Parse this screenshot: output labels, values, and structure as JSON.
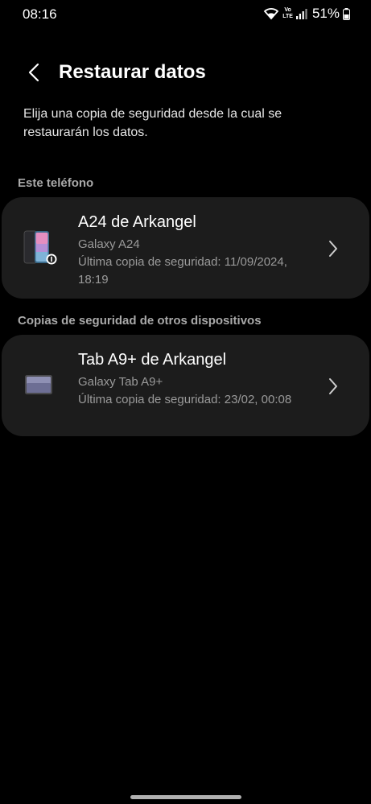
{
  "status_bar": {
    "time": "08:16",
    "network_label_top": "Vo",
    "network_label_bottom": "LTE",
    "battery": "51%"
  },
  "header": {
    "title": "Restaurar datos",
    "back_icon": "chevron-left-icon"
  },
  "description": "Elija una copia de seguridad desde la cual se restaurarán los datos.",
  "sections": [
    {
      "label": "Este teléfono",
      "device": {
        "name": "A24 de Arkangel",
        "model": "Galaxy A24",
        "last_backup": "Última copia de seguridad: 11/09/2024, 18:19",
        "icon": "phone-icon"
      }
    },
    {
      "label": "Copias de seguridad de otros dispositivos",
      "device": {
        "name": "Tab A9+ de Arkangel",
        "model": "Galaxy Tab A9+",
        "last_backup": "Última copia de seguridad: 23/02, 00:08",
        "icon": "tablet-icon"
      }
    }
  ],
  "colors": {
    "background": "#000000",
    "card": "#1c1c1c",
    "secondary_text": "#9a9a9a",
    "section_label": "#a9a9a9"
  }
}
